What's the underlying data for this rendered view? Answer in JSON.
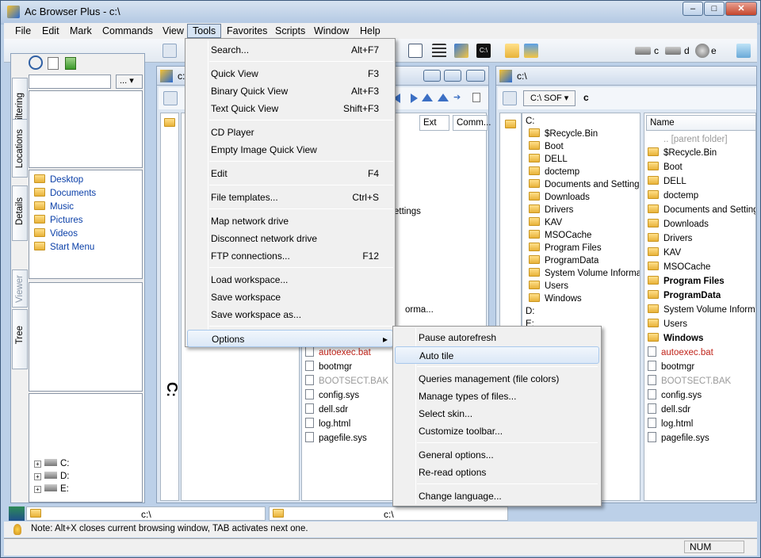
{
  "window": {
    "title": "Ac Browser Plus - c:\\",
    "controls": {
      "minimize": "–",
      "maximize": "□",
      "close": "✕"
    }
  },
  "menubar": [
    "File",
    "Edit",
    "Mark",
    "Commands",
    "View",
    "Tools",
    "Favorites",
    "Scripts",
    "Window",
    "Help"
  ],
  "left": {
    "tabs": [
      "Filtering",
      "Locations",
      "Details",
      "Viewer",
      "Tree"
    ],
    "dropdown_btn": "...",
    "locations": [
      "Desktop",
      "Documents",
      "Music",
      "Pictures",
      "Videos",
      "Start Menu"
    ],
    "tree": [
      "C:",
      "D:",
      "E:"
    ]
  },
  "left_panel": {
    "path": "c:\\",
    "headers": {
      "ext": "Ext",
      "comm": "Comm..."
    },
    "partial": [
      "ettings",
      "orma..."
    ],
    "files": [
      {
        "name": "autoexec.bat",
        "style": "red"
      },
      {
        "name": "bootmgr",
        "style": ""
      },
      {
        "name": "BOOTSECT.BAK",
        "style": "gray"
      },
      {
        "name": "config.sys",
        "style": ""
      },
      {
        "name": "dell.sdr",
        "style": ""
      },
      {
        "name": "log.html",
        "style": ""
      },
      {
        "name": "pagefile.sys",
        "style": ""
      }
    ],
    "bottom_path": "c:\\",
    "big_glyph": "C:"
  },
  "right_panel": {
    "path": "c:\\",
    "drive_combo": "C:\\ SOF",
    "drive_letter": "c",
    "tree_root": "C:",
    "tree": [
      "$Recycle.Bin",
      "Boot",
      "DELL",
      "doctemp",
      "Documents and Settings",
      "Downloads",
      "Drivers",
      "KAV",
      "MSOCache",
      "Program Files",
      "ProgramData",
      "System Volume Informati",
      "Users",
      "Windows"
    ],
    "tree_drives": [
      "D:",
      "E:"
    ],
    "list_header": "Name",
    "list": [
      {
        "name": "..    [parent folder]",
        "style": "gray",
        "kind": "up"
      },
      {
        "name": "$Recycle.Bin",
        "style": "",
        "kind": "folder"
      },
      {
        "name": "Boot",
        "style": "",
        "kind": "folder"
      },
      {
        "name": "DELL",
        "style": "",
        "kind": "folder"
      },
      {
        "name": "doctemp",
        "style": "",
        "kind": "folder"
      },
      {
        "name": "Documents and Settings",
        "style": "",
        "kind": "folder"
      },
      {
        "name": "Downloads",
        "style": "",
        "kind": "folder"
      },
      {
        "name": "Drivers",
        "style": "",
        "kind": "folder"
      },
      {
        "name": "KAV",
        "style": "",
        "kind": "folder"
      },
      {
        "name": "MSOCache",
        "style": "",
        "kind": "folder"
      },
      {
        "name": "Program Files",
        "style": "bold",
        "kind": "folder"
      },
      {
        "name": "ProgramData",
        "style": "bold",
        "kind": "folder"
      },
      {
        "name": "System Volume Informa",
        "style": "",
        "kind": "folder"
      },
      {
        "name": "Users",
        "style": "",
        "kind": "folder"
      },
      {
        "name": "Windows",
        "style": "bold",
        "kind": "folder"
      },
      {
        "name": "autoexec.bat",
        "style": "red",
        "kind": "file"
      },
      {
        "name": "bootmgr",
        "style": "",
        "kind": "file"
      },
      {
        "name": "BOOTSECT.BAK",
        "style": "gray",
        "kind": "file"
      },
      {
        "name": "config.sys",
        "style": "",
        "kind": "file"
      },
      {
        "name": "dell.sdr",
        "style": "",
        "kind": "file"
      },
      {
        "name": "log.html",
        "style": "",
        "kind": "file"
      },
      {
        "name": "pagefile.sys",
        "style": "",
        "kind": "file"
      }
    ],
    "bottom_path": "c:\\"
  },
  "toolbar": {
    "drives": [
      "c",
      "d",
      "e"
    ]
  },
  "tools_menu": [
    {
      "label": "Search...",
      "shortcut": "Alt+F7"
    },
    {
      "sep": true
    },
    {
      "label": "Quick View",
      "shortcut": "F3"
    },
    {
      "label": "Binary Quick View",
      "shortcut": "Alt+F3"
    },
    {
      "label": "Text Quick View",
      "shortcut": "Shift+F3"
    },
    {
      "sep": true
    },
    {
      "label": "CD Player",
      "shortcut": ""
    },
    {
      "label": "Empty Image Quick View",
      "shortcut": ""
    },
    {
      "sep": true
    },
    {
      "label": "Edit",
      "shortcut": "F4"
    },
    {
      "sep": true
    },
    {
      "label": "File templates...",
      "shortcut": "Ctrl+S"
    },
    {
      "sep": true
    },
    {
      "label": "Map network drive",
      "shortcut": ""
    },
    {
      "label": "Disconnect network drive",
      "shortcut": ""
    },
    {
      "label": "FTP connections...",
      "shortcut": "F12"
    },
    {
      "sep": true
    },
    {
      "label": "Load workspace...",
      "shortcut": ""
    },
    {
      "label": "Save workspace",
      "shortcut": ""
    },
    {
      "label": "Save workspace as...",
      "shortcut": ""
    },
    {
      "sep": true
    },
    {
      "label": "Options",
      "shortcut": "",
      "submenu": true
    }
  ],
  "options_menu": [
    {
      "label": "Pause autorefresh"
    },
    {
      "label": "Auto tile",
      "hl": true
    },
    {
      "sep": true
    },
    {
      "label": "Queries management (file colors)"
    },
    {
      "label": "Manage types of files..."
    },
    {
      "label": "Select skin..."
    },
    {
      "label": "Customize toolbar..."
    },
    {
      "sep": true
    },
    {
      "label": "General options..."
    },
    {
      "label": "Re-read options"
    },
    {
      "sep": true
    },
    {
      "label": "Change language..."
    }
  ],
  "note": "Note: Alt+X closes current browsing window, TAB activates next one.",
  "status": {
    "num": "NUM"
  },
  "colors": {
    "accent": "#0a3fa8",
    "red": "#c0241a",
    "highlight": "#dbe8f7"
  }
}
